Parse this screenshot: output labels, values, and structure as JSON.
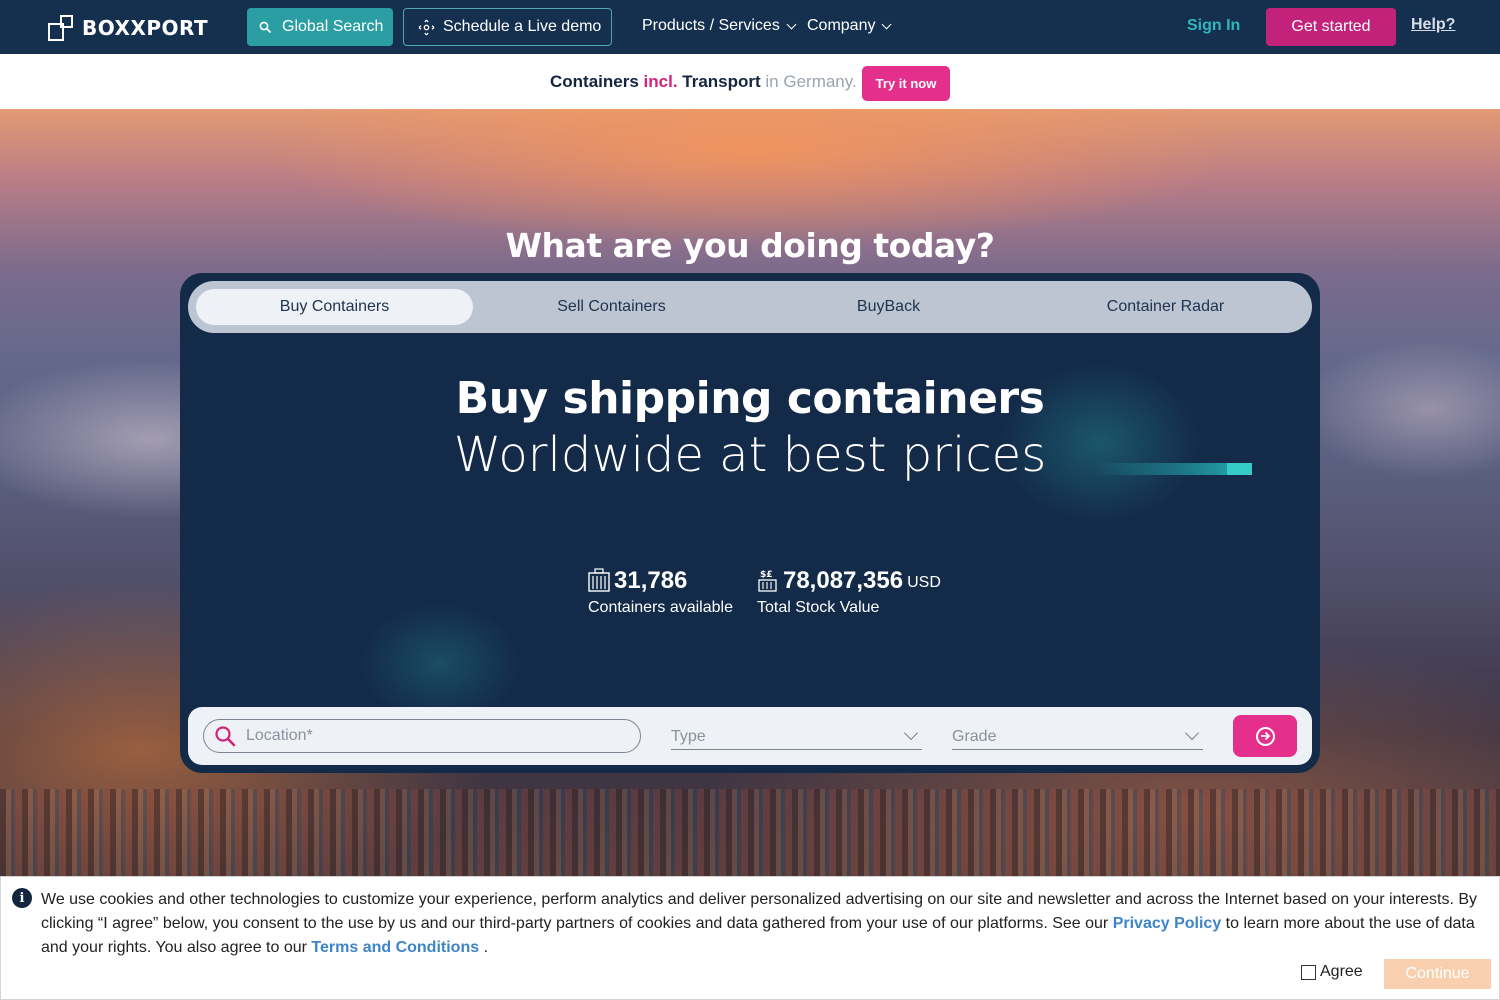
{
  "brand": {
    "name": "BOXXPORT"
  },
  "nav": {
    "global_search": "Global Search",
    "schedule_demo": "Schedule a Live demo",
    "products": "Products / Services",
    "company": "Company",
    "signin": "Sign In",
    "get_started": "Get started",
    "help": "Help?"
  },
  "promo": {
    "part1": "Containers ",
    "part2": "incl.",
    "part3": " Transport",
    "part4": " in Germany.",
    "try_label": "Try it now"
  },
  "hero": {
    "question": "What are you doing today?",
    "tabs": [
      {
        "label": "Buy Containers",
        "active": true
      },
      {
        "label": "Sell Containers",
        "active": false
      },
      {
        "label": "BuyBack",
        "active": false
      },
      {
        "label": "Container Radar",
        "active": false
      }
    ],
    "headline_bold": "Buy shipping containers",
    "headline_light": "Worldwide at best prices",
    "stats": [
      {
        "value": "31,786",
        "unit": "",
        "label": "Containers available",
        "icon": "containers-icon"
      },
      {
        "value": "78,087,356",
        "unit": "USD",
        "label": "Total Stock Value",
        "icon": "stock-value-icon"
      }
    ],
    "search": {
      "location_placeholder": "Location*",
      "type_placeholder": "Type",
      "grade_placeholder": "Grade"
    }
  },
  "cookie": {
    "text1": "We use cookies and other technologies to customize your experience, perform analytics and deliver personalized advertising on our site and newsletter and across the Internet based on your interests. By clicking “I agree” below, you consent to the use by us and our third-party partners of cookies and data gathered from your use of our platforms. See our ",
    "privacy_link": "Privacy Policy",
    "text2": " to learn more about the use of data and your rights. You also agree to our ",
    "terms_link": "Terms and Conditions",
    "text3": " .",
    "agree_label": "Agree",
    "continue_label": "Continue"
  },
  "colors": {
    "nav_bg": "#15304f",
    "accent_teal": "#2b9ea3",
    "accent_pink": "#e42f8c",
    "panel_bg": "#132b49"
  }
}
